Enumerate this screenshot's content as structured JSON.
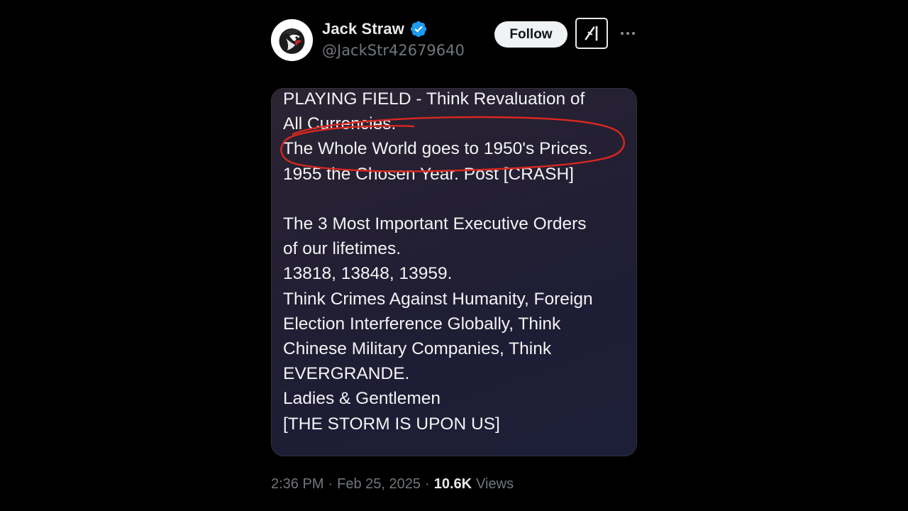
{
  "author": {
    "display_name": "Jack Straw",
    "handle": "@JackStr42679640",
    "verified": true,
    "avatar_icon": "hawk-head-avatar"
  },
  "actions": {
    "follow_label": "Follow",
    "grok_icon": "grok-icon",
    "more_icon": "more-options-icon"
  },
  "post_image": {
    "lines_before": [
      "PLAYING FIELD - Think Revaluation of",
      "All Currencies.",
      "The Whole World goes to 1950's Prices.",
      "1955 the Chosen Year. Post [CRASH]"
    ],
    "lines_after": [
      "The 3 Most Important Executive Orders",
      "of our lifetimes.",
      "13818, 13848, 13959.",
      "Think Crimes Against Humanity, Foreign",
      "Election Interference Globally, Think",
      "Chinese Military Companies, Think",
      "EVERGRANDE.",
      "Ladies & Gentlemen",
      "[THE STORM IS UPON US]"
    ],
    "annotation_color": "#d8281f"
  },
  "footer": {
    "time": "2:36 PM",
    "date": "Feb 25, 2025",
    "separator": "·",
    "views_count": "10.6K",
    "views_label": "Views"
  },
  "colors": {
    "background": "#000000",
    "verified_blue": "#1d9bf0",
    "primary_text": "#e7e9ea",
    "secondary_text": "#71767b"
  }
}
